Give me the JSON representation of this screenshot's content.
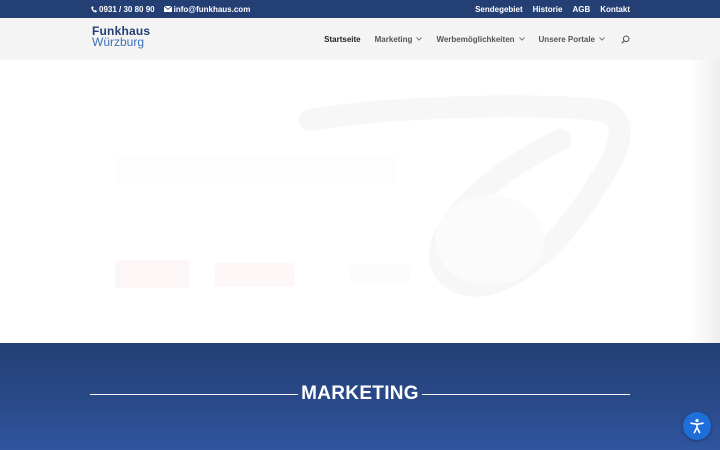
{
  "topbar": {
    "phone": "0931 / 30 80 90",
    "email": "info@funkhaus.com",
    "links": [
      "Sendegebiet",
      "Historie",
      "AGB",
      "Kontakt"
    ]
  },
  "logo": {
    "line1": "Funkhaus",
    "line2": "Würzburg"
  },
  "nav": {
    "items": [
      {
        "label": "Startseite",
        "active": true,
        "dropdown": false
      },
      {
        "label": "Marketing",
        "active": false,
        "dropdown": true
      },
      {
        "label": "Werbemöglichkeiten",
        "active": false,
        "dropdown": true
      },
      {
        "label": "Unsere Portale",
        "active": false,
        "dropdown": true
      }
    ],
    "search_icon": "search-icon"
  },
  "section": {
    "heading": "MARKETING"
  },
  "accessibility": {
    "icon": "accessibility-icon",
    "color": "#1e6fd9"
  },
  "colors": {
    "topbar": "#243f74",
    "brand_light": "#3b72b8",
    "section_bg": "#2a4a8a"
  }
}
